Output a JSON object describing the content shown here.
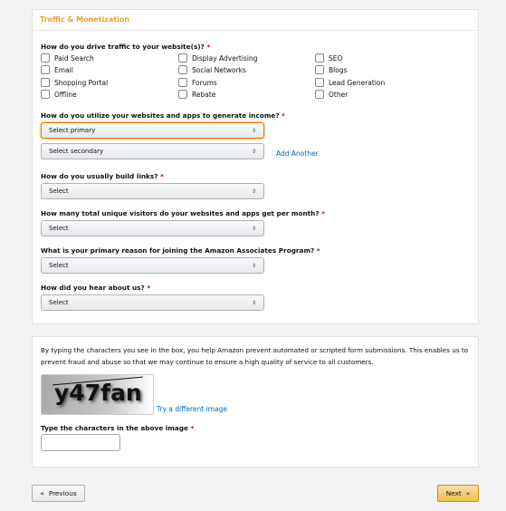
{
  "section_title": "Traffic & Monetization",
  "q1": {
    "label": "How do you drive traffic to your website(s)?",
    "options": [
      "Paid Search",
      "Email",
      "Shopping Portal",
      "Offline",
      "Display Advertising",
      "Social Networks",
      "Forums",
      "Rebate",
      "SEO",
      "Blogs",
      "Lead Generation",
      "Other"
    ]
  },
  "q2": {
    "label": "How do you utilize your websites and apps to generate income?",
    "primary": "Select primary",
    "secondary": "Select secondary",
    "add_another": "Add Another"
  },
  "q3": {
    "label": "How do you usually build links?",
    "value": "Select"
  },
  "q4": {
    "label": "How many total unique visitors do your websites and apps get per month?",
    "value": "Select"
  },
  "q5": {
    "label": "What is your primary reason for joining the Amazon Associates Program?",
    "value": "Select"
  },
  "q6": {
    "label": "How did you hear about us?",
    "value": "Select"
  },
  "required_mark": "*",
  "captcha": {
    "description": "By typing the characters you see in the box, you help Amazon prevent automated or scripted form submissions. This enables us to prevent fraud and abuse so that we may continue to ensure a high quality of service to all customers.",
    "image_text": "y47fan",
    "try_different": "Try a different image",
    "input_label": "Type the characters in the above image",
    "input_value": ""
  },
  "nav": {
    "previous": "Previous",
    "next": "Next"
  },
  "colors": {
    "accent": "#f0a030",
    "link": "#0066c0",
    "next_button": "#f0c14b"
  }
}
